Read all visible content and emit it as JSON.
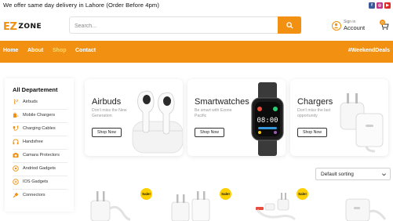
{
  "topbar": {
    "message": "We offer same day delivery in Lahore (Order Before 4pm)",
    "social": [
      "facebook-icon",
      "instagram-icon",
      "youtube-icon"
    ]
  },
  "header": {
    "logo": {
      "ez": "EZ",
      "zone": "ZONE"
    },
    "search_placeholder": "Search...",
    "account": {
      "small": "Sign in",
      "big": "Account"
    },
    "cart_count": "0"
  },
  "nav": {
    "items": [
      {
        "label": "Home"
      },
      {
        "label": "About"
      },
      {
        "label": "Shop",
        "active": true
      },
      {
        "label": "Contact"
      }
    ],
    "promo": "#WeekendDeals"
  },
  "sidebar": {
    "title": "All Departement",
    "items": [
      {
        "label": "Airbuds",
        "icon": "airbuds-icon"
      },
      {
        "label": "Mobile Chargers",
        "icon": "charger-icon"
      },
      {
        "label": "Charging Cables",
        "icon": "cable-icon"
      },
      {
        "label": "Handsfree",
        "icon": "headphones-icon"
      },
      {
        "label": "Camara Protectors",
        "icon": "camera-icon"
      },
      {
        "label": "Andriod Gadgets",
        "icon": "android-icon"
      },
      {
        "label": "IOS Gadgets",
        "icon": "ios-icon"
      },
      {
        "label": "Connectors",
        "icon": "connector-icon"
      }
    ]
  },
  "banners": [
    {
      "title": "Airbuds",
      "subtitle": "Don't miss the New Generation",
      "button": "Shop Now"
    },
    {
      "title": "Smartwatches",
      "subtitle": "Be smart with Ezone Pacific",
      "button": "Shop Now"
    },
    {
      "title": "Chargers",
      "subtitle": "Don't miss the last opportunity",
      "button": "Shop Now"
    }
  ],
  "watch_time": "08:00",
  "sorting": {
    "value": "Default sorting"
  },
  "products": [
    {
      "badge": "Sale!"
    },
    {
      "badge": "Sale!"
    },
    {
      "badge": "Sale!"
    },
    {
      "badge": ""
    }
  ],
  "colors": {
    "accent": "#f29111",
    "nav_active": "#ffd76a",
    "sale_badge": "#ffd000"
  }
}
